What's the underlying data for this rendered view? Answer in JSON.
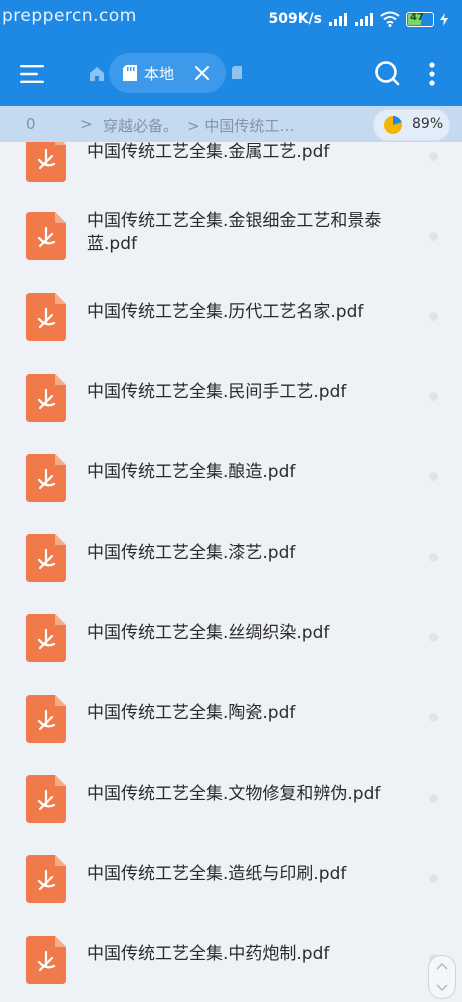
{
  "status_bar": {
    "watermark": "prepperc​n.com",
    "speed": "509K/s",
    "battery": "47"
  },
  "toolbar": {
    "menu_icon": "hamburger-menu-icon",
    "home_icon": "home-icon",
    "active_tab_label": "本地",
    "search_icon": "search-icon",
    "more_icon": "more-vertical-icon"
  },
  "breadcrumb": {
    "root": "0",
    "separator": ">",
    "item1": "穿越必备。",
    "item2": "> 中国传统工…",
    "storage_percent": "89%"
  },
  "files": [
    {
      "name": "中国传统工艺全集.金属工艺.pdf"
    },
    {
      "name": "中国传统工艺全集.金银细金工艺和景泰蓝.pdf",
      "line1": "中国传统工艺全集.金银细金工艺和景泰",
      "line2": "蓝.pdf"
    },
    {
      "name": "中国传统工艺全集.历代工艺名家.pdf"
    },
    {
      "name": "中国传统工艺全集.民间手工艺.pdf"
    },
    {
      "name": "中国传统工艺全集.酿造.pdf"
    },
    {
      "name": "中国传统工艺全集.漆艺.pdf"
    },
    {
      "name": "中国传统工艺全集.丝绸织染.pdf"
    },
    {
      "name": "中国传统工艺全集.陶瓷.pdf"
    },
    {
      "name": "中国传统工艺全集.文物修复和辨伪.pdf"
    },
    {
      "name": "中国传统工艺全集.造纸与印刷.pdf"
    },
    {
      "name": "中国传统工艺全集.中药炮制.pdf"
    }
  ],
  "colors": {
    "header": "#1e88e5",
    "pdf_icon": "#f07a4a",
    "background": "#eef1f5"
  }
}
